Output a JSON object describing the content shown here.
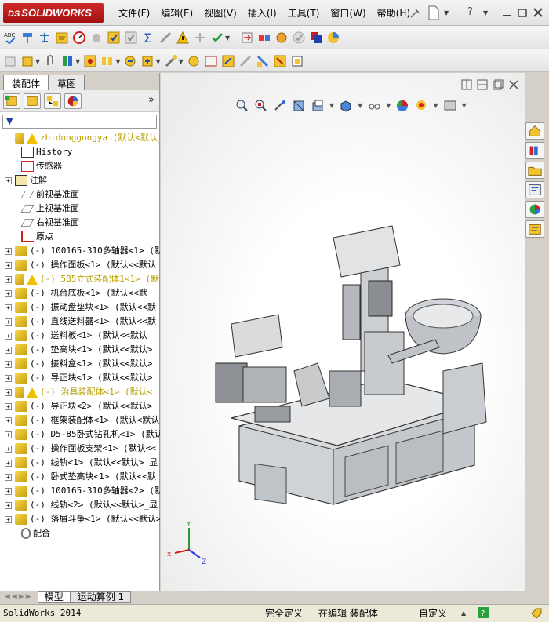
{
  "app": {
    "logo_prefix": "DS",
    "logo_text": "SOLIDWORKS"
  },
  "menu": [
    "文件(F)",
    "编辑(E)",
    "视图(V)",
    "插入(I)",
    "工具(T)",
    "窗口(W)",
    "帮助(H)"
  ],
  "left_tabs": [
    "装配体",
    "草图"
  ],
  "tree": {
    "root": "zhidonggongya (默认<默认_显",
    "items": [
      {
        "label": "History",
        "type": "history",
        "expand": false
      },
      {
        "label": "传感器",
        "type": "sensor",
        "expand": false
      },
      {
        "label": "注解",
        "type": "annotation",
        "expand": true
      },
      {
        "label": "前视基准面",
        "type": "plane",
        "expand": false
      },
      {
        "label": "上视基准面",
        "type": "plane",
        "expand": false
      },
      {
        "label": "右视基准面",
        "type": "plane",
        "expand": false
      },
      {
        "label": "原点",
        "type": "origin",
        "expand": false
      },
      {
        "label": "(-) 100165-310多轴器<1> (默",
        "type": "part",
        "expand": true
      },
      {
        "label": "(-) 操作面板<1> (默认<<默认",
        "type": "part",
        "expand": true
      },
      {
        "label": "(-) 585立式装配体1<1> (默",
        "type": "warnpart",
        "expand": true
      },
      {
        "label": "(-) 机台底板<1> (默认<<默",
        "type": "part",
        "expand": true
      },
      {
        "label": "(-) 振动盘垫块<1> (默认<<默",
        "type": "part",
        "expand": true
      },
      {
        "label": "(-) 直线送料器<1> (默认<<默",
        "type": "part",
        "expand": true
      },
      {
        "label": "(-) 送料板<1> (默认<<默认",
        "type": "part",
        "expand": true
      },
      {
        "label": "(-) 垫高块<1> (默认<<默认>",
        "type": "part",
        "expand": true
      },
      {
        "label": "(-) 接料盒<1> (默认<<默认>",
        "type": "part",
        "expand": true
      },
      {
        "label": "(-) 导正块<1> (默认<<默认>",
        "type": "part",
        "expand": true
      },
      {
        "label": "(-) 治具装配体<1> (默认<",
        "type": "warnpart",
        "expand": true
      },
      {
        "label": "(-) 导正块<2> (默认<<默认>",
        "type": "part",
        "expand": true
      },
      {
        "label": "(-) 框架装配体<1> (默认<默认",
        "type": "part",
        "expand": true
      },
      {
        "label": "(-) D5-85卧式钻孔机<1> (默认",
        "type": "part",
        "expand": true
      },
      {
        "label": "(-) 操作面板支架<1> (默认<<",
        "type": "part",
        "expand": true
      },
      {
        "label": "(-) 线轨<1> (默认<<默认>_显",
        "type": "part",
        "expand": true
      },
      {
        "label": "(-) 卧式垫高块<1> (默认<<默",
        "type": "part",
        "expand": true
      },
      {
        "label": "(-) 100165-310多轴器<2> (默",
        "type": "part",
        "expand": true
      },
      {
        "label": "(-) 线轨<2> (默认<<默认>_显",
        "type": "part",
        "expand": true
      },
      {
        "label": "(-) 落屑斗争<1> (默认<<默认>",
        "type": "part",
        "expand": true
      },
      {
        "label": "配合",
        "type": "mates",
        "expand": false
      }
    ]
  },
  "triad": {
    "x": "x",
    "y": "Y",
    "z": "Z"
  },
  "bottom_tabs": [
    "模型",
    "运动算例 1"
  ],
  "status": {
    "app": "SolidWorks 2014",
    "defined": "完全定义",
    "editing": "在编辑 装配体",
    "custom": "自定义"
  }
}
